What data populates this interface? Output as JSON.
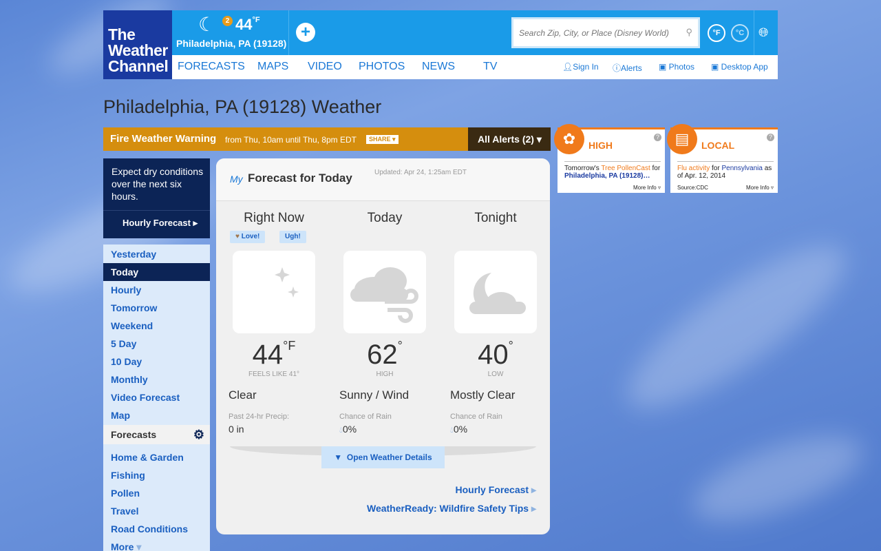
{
  "brand": {
    "logo_lines": [
      "The",
      "Weather",
      "Channel"
    ]
  },
  "header": {
    "alert_count": "2",
    "current_temp": "44",
    "current_unit": "°F",
    "current_location": "Philadelphia, PA (19128)",
    "search_placeholder": "Search Zip, City, or Place (Disney World)",
    "unit_f": "°F",
    "unit_c": "°C"
  },
  "nav": {
    "main": [
      "FORECASTS",
      "MAPS",
      "VIDEO",
      "PHOTOS",
      "NEWS",
      "TV"
    ],
    "utility": [
      "Sign In",
      "Alerts",
      "Photos",
      "Desktop App"
    ]
  },
  "page_title": "Philadelphia, PA (19128) Weather",
  "alert": {
    "title": "Fire Weather Warning",
    "time": "from Thu, 10am until Thu, 8pm EDT",
    "share": "SHARE",
    "all_alerts": "All Alerts (2)"
  },
  "ads": [
    {
      "head": "HIGH",
      "body1": "Tomorrow's ",
      "body2": "Tree PollenCast",
      "body3": " for ",
      "body4": "Philadelphia, PA (19128)…",
      "more": "More Info"
    },
    {
      "head": "LOCAL",
      "body1": "Flu activity",
      "body2": " for ",
      "body3": "Pennsylvania",
      "body4": " as of Apr. 12, 2014",
      "source": "Source:CDC",
      "more": "More Info"
    }
  ],
  "sidebar": {
    "message": "Expect dry conditions over the next six hours.",
    "hourly": "Hourly Forecast",
    "items": [
      "Yesterday",
      "Today",
      "Hourly",
      "Tomorrow",
      "Weekend",
      "5 Day",
      "10 Day",
      "Monthly",
      "Video Forecast",
      "Map"
    ],
    "section_head": "Forecasts",
    "more_items": [
      "Home & Garden",
      "Fishing",
      "Pollen",
      "Travel",
      "Road Conditions",
      "More"
    ]
  },
  "forecast": {
    "my": "My",
    "title": "Forecast for Today",
    "updated": "Updated: Apr 24, 1:25am EDT",
    "love": "Love!",
    "ugh": "Ugh!",
    "columns": [
      {
        "head": "Right Now",
        "temp": "44",
        "unit": "°F",
        "sub": "FEELS LIKE 41°",
        "cond": "Clear",
        "plab": "Past 24-hr Precip:",
        "pval": "0 in",
        "icon": "moon-stars-icon"
      },
      {
        "head": "Today",
        "temp": "62",
        "unit": "°",
        "sub": "HIGH",
        "cond": "Sunny / Wind",
        "plab": "Chance of Rain",
        "pval": "0%",
        "icon": "cloud-wind-icon"
      },
      {
        "head": "Tonight",
        "temp": "40",
        "unit": "°",
        "sub": "LOW",
        "cond": "Mostly Clear",
        "plab": "Chance of Rain",
        "pval": "0%",
        "icon": "moon-cloud-icon"
      }
    ],
    "details_btn": "Open Weather Details",
    "link1": "Hourly Forecast",
    "link2": "WeatherReady: Wildfire Safety Tips"
  }
}
